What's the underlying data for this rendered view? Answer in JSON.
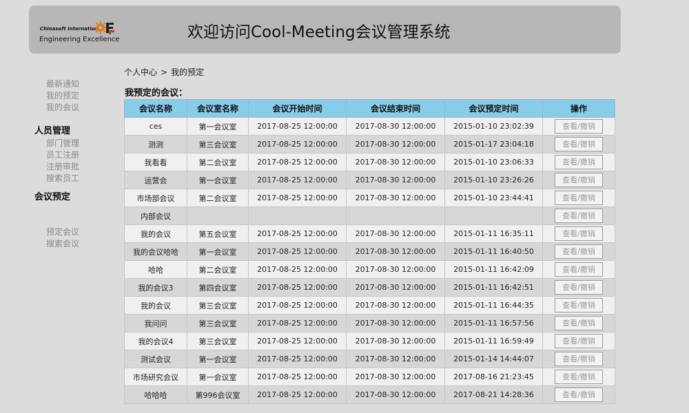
{
  "header": {
    "logo_small": "Chinasoft International",
    "logo_main": "Engineering Excellence",
    "title": "欢迎访问Cool-Meeting会议管理系统"
  },
  "sidebar": {
    "group1": [
      "最新通知",
      "我的预定",
      "我的会议"
    ],
    "group2_title": "人员管理",
    "group2": [
      "部门管理",
      "员工注册",
      "注册审批",
      "搜索员工"
    ],
    "group3_title": "会议预定",
    "group3": [
      "预定会议",
      "搜索会议"
    ]
  },
  "breadcrumb": {
    "parent": "个人中心",
    "separator": ">",
    "current": "我的预定"
  },
  "section_title": "我预定的会议：",
  "table": {
    "columns": [
      "会议名称",
      "会议室名称",
      "会议开始时间",
      "会议结束时间",
      "会议预定时间",
      "操作"
    ],
    "action_label": "查看/撤销",
    "rows": [
      [
        "ces",
        "第一会议室",
        "2017-08-25 12:00:00",
        "2017-08-30 12:00:00",
        "2015-01-10 23:02:39"
      ],
      [
        "测测",
        "第三会议室",
        "2017-08-25 12:00:00",
        "2017-08-30 12:00:00",
        "2015-01-17 23:04:18"
      ],
      [
        "我看看",
        "第二会议室",
        "2017-08-25 12:00:00",
        "2017-08-30 12:00:00",
        "2015-01-10 23:06:33"
      ],
      [
        "运营会",
        "第一会议室",
        "2017-08-25 12:00:00",
        "2017-08-30 12:00:00",
        "2015-01-10 23:26:26"
      ],
      [
        "市场部会议",
        "第二会议室",
        "2017-08-25 12:00:00",
        "2017-08-30 12:00:00",
        "2015-01-10 23:44:41"
      ],
      [
        "内部会议",
        "",
        "",
        "",
        ""
      ],
      [
        "我的会议",
        "第五会议室",
        "2017-08-25 12:00:00",
        "2017-08-30 12:00:00",
        "2015-01-11 16:35:11"
      ],
      [
        "我的会议哈哈",
        "第一会议室",
        "2017-08-25 12:00:00",
        "2017-08-30 12:00:00",
        "2015-01-11 16:40:50"
      ],
      [
        "哈哈",
        "第二会议室",
        "2017-08-25 12:00:00",
        "2017-08-30 12:00:00",
        "2015-01-11 16:42:09"
      ],
      [
        "我的会议3",
        "第四会议室",
        "2017-08-25 12:00:00",
        "2017-08-30 12:00:00",
        "2015-01-11 16:42:51"
      ],
      [
        "我的会议",
        "第三会议室",
        "2017-08-25 12:00:00",
        "2017-08-30 12:00:00",
        "2015-01-11 16:44:35"
      ],
      [
        "我问问",
        "第三会议室",
        "2017-08-25 12:00:00",
        "2017-08-30 12:00:00",
        "2015-01-11 16:57:56"
      ],
      [
        "我的会议4",
        "第三会议室",
        "2017-08-25 12:00:00",
        "2017-08-30 12:00:00",
        "2015-01-11 16:59:49"
      ],
      [
        "测试会议",
        "第一会议室",
        "2017-08-25 12:00:00",
        "2017-08-30 12:00:00",
        "2015-01-14 14:44:07"
      ],
      [
        "市场研究会议",
        "第一会议室",
        "2017-08-25 12:00:00",
        "2017-08-30 12:00:00",
        "2017-08-16 21:23:45"
      ],
      [
        "哈哈哈",
        "第996会议室",
        "2017-08-25 12:00:00",
        "2017-08-30 12:00:00",
        "2017-08-21 14:28:36"
      ]
    ]
  },
  "colors": {
    "header_bg": "#b7b7b7",
    "page_bg": "#dcdcdc",
    "table_header_bg": "#87cdea",
    "row_odd_bg": "#f0f0f0",
    "row_even_bg": "#d7d7d7",
    "sidebar_link": "#8a8a8a"
  },
  "icons": {
    "logo": "gear-logo-icon"
  }
}
